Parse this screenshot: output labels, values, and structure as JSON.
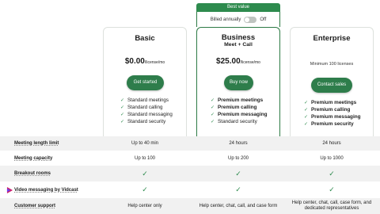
{
  "best_value_label": "Best value",
  "billing": {
    "label": "Billed annually",
    "toggle_state": "Off"
  },
  "plans": [
    {
      "name": "Basic",
      "subtitle": "",
      "price": "$0.00",
      "price_unit": "/license/mo",
      "note": "",
      "cta": "Get started",
      "features": [
        "Standard meetings",
        "Standard calling",
        "Standard messaging",
        "Standard security"
      ]
    },
    {
      "name": "Business",
      "subtitle": "Meet + Call",
      "price": "$25.00",
      "price_unit": "/license/mo",
      "note": "",
      "cta": "Buy now",
      "features": [
        "Premium meetings",
        "Premium calling",
        "Premium messaging",
        "Standard security"
      ]
    },
    {
      "name": "Enterprise",
      "subtitle": "",
      "price": "",
      "price_unit": "",
      "note": "Minimum 100 licenses",
      "cta": "Contact sales",
      "features": [
        "Premium meetings",
        "Premium calling",
        "Premium messaging",
        "Premium security"
      ]
    }
  ],
  "comparison": [
    {
      "label": "Meeting length limit",
      "values": [
        "Up to 40 min",
        "24 hours",
        "24 hours"
      ]
    },
    {
      "label": "Meeting capacity",
      "values": [
        "Up to 100",
        "Up to 200",
        "Up to 1000"
      ]
    },
    {
      "label": "Breakout rooms",
      "values": [
        "check",
        "check",
        "check"
      ]
    },
    {
      "label": "Video messaging by Vidcast",
      "values": [
        "check",
        "check",
        "check"
      ]
    },
    {
      "label": "Customer support",
      "values": [
        "Help center only",
        "Help center, chat, call, and case form",
        "Help center, chat, call, case form, and dedicated representatives"
      ]
    }
  ],
  "colors": {
    "accent": "#2e7d4b",
    "check": "#2e8b4e",
    "row_shade": "#f1f1f1"
  },
  "icons": {
    "check": "check-icon",
    "vidcast": "vidcast-icon"
  }
}
